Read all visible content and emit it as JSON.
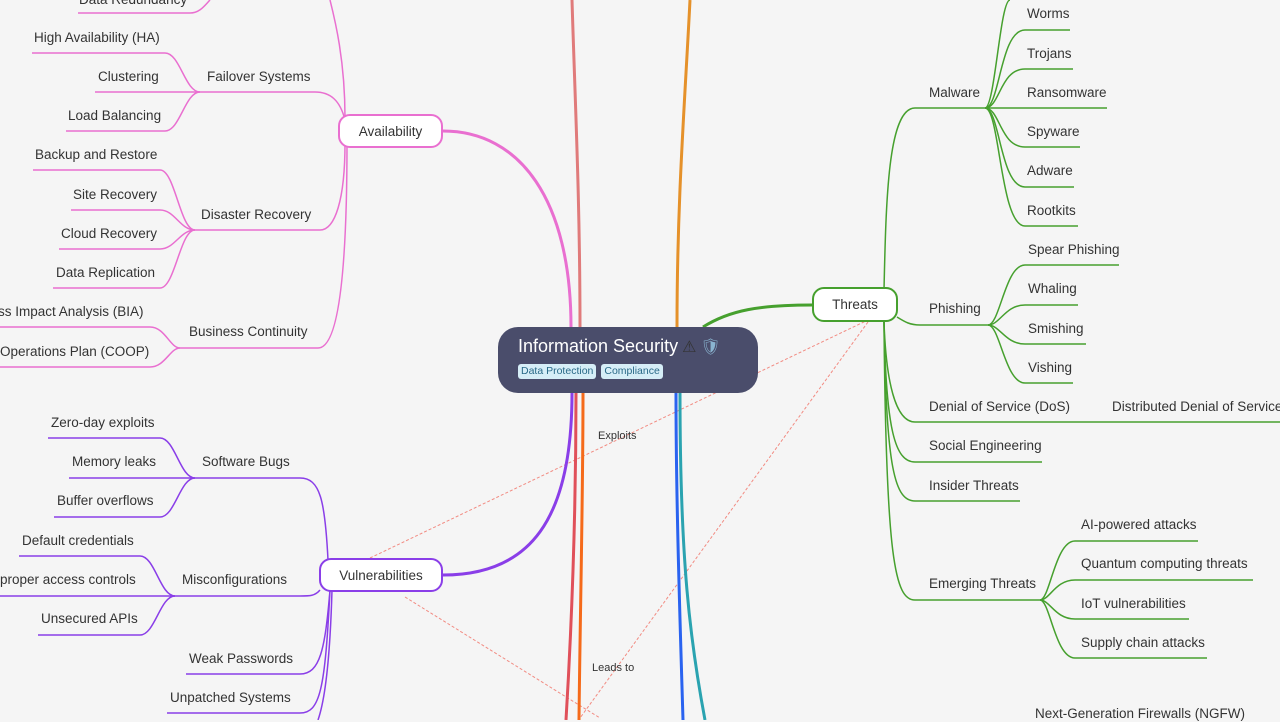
{
  "root": {
    "title": "Information Security",
    "icons": [
      "warning-icon",
      "shield-icon"
    ],
    "tags": [
      "Data Protection",
      "Compliance"
    ]
  },
  "colors": {
    "availability": "#e96fd0",
    "vulnerabilities": "#8a3ee8",
    "threats": "#46a02e",
    "root_bg": "#4a4d6b",
    "relationship": "#f28b82"
  },
  "availability": {
    "label": "Availability",
    "partial_top": "Data Redundancy",
    "groups": [
      {
        "label": "Failover Systems",
        "children": [
          "High Availability (HA)",
          "Clustering",
          "Load Balancing"
        ]
      },
      {
        "label": "Disaster Recovery",
        "children": [
          "Backup and Restore",
          "Site Recovery",
          "Cloud Recovery",
          "Data Replication"
        ]
      },
      {
        "label": "Business Continuity",
        "children": [
          "ss Impact Analysis (BIA)",
          "Operations Plan (COOP)"
        ]
      }
    ]
  },
  "vulnerabilities": {
    "label": "Vulnerabilities",
    "groups": [
      {
        "label": "Software Bugs",
        "children": [
          "Zero-day exploits",
          "Memory leaks",
          "Buffer overflows"
        ]
      },
      {
        "label": "Misconfigurations",
        "children": [
          "Default credentials",
          "proper access controls",
          "Unsecured APIs"
        ]
      },
      {
        "label": "Weak Passwords",
        "children": []
      },
      {
        "label": "Unpatched Systems",
        "children": []
      }
    ]
  },
  "threats": {
    "label": "Threats",
    "groups": [
      {
        "label": "Malware",
        "children": [
          "Worms",
          "Trojans",
          "Ransomware",
          "Spyware",
          "Adware",
          "Rootkits"
        ]
      },
      {
        "label": "Phishing",
        "children": [
          "Spear Phishing",
          "Whaling",
          "Smishing",
          "Vishing"
        ]
      },
      {
        "label": "Denial of Service (DoS)",
        "children": [
          "Distributed Denial of Service"
        ]
      },
      {
        "label": "Social Engineering",
        "children": []
      },
      {
        "label": "Insider Threats",
        "children": []
      },
      {
        "label": "Emerging Threats",
        "children": [
          "AI-powered attacks",
          "Quantum computing threats",
          "IoT vulnerabilities",
          "Supply chain attacks"
        ]
      }
    ]
  },
  "partial_bottom_right": "Next-Generation Firewalls (NGFW)",
  "relationships": [
    {
      "label": "Exploits"
    },
    {
      "label": "Leads to"
    }
  ]
}
